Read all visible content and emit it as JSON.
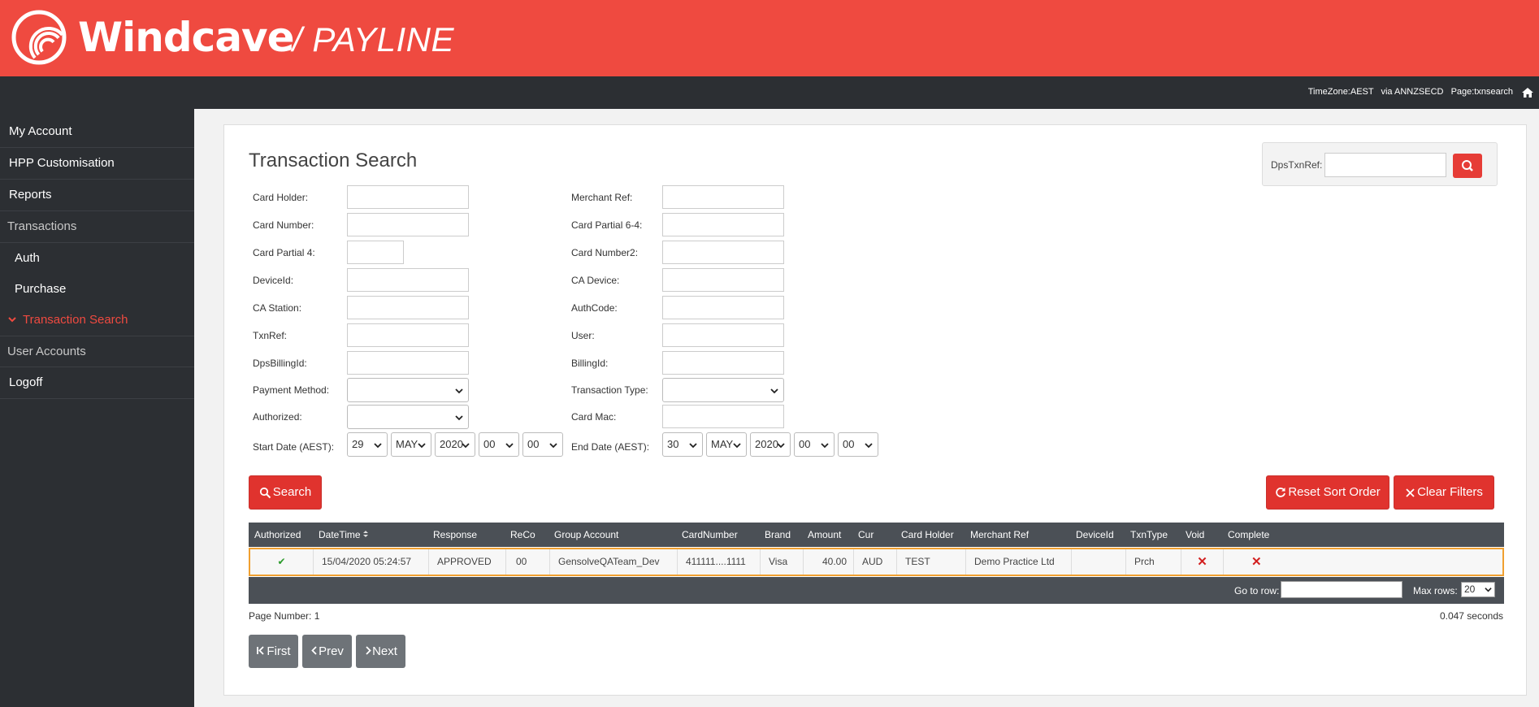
{
  "brand": {
    "name": "Windcave",
    "product": "/ PAYLINE",
    "color": "#ef4a40"
  },
  "status": {
    "timezone": "TimeZone:AEST",
    "via": "via ANNZSECD",
    "page": "Page:txnsearch"
  },
  "sidebar": {
    "items": [
      {
        "label": "My Account"
      },
      {
        "label": "HPP Customisation"
      },
      {
        "label": "Reports"
      },
      {
        "label": "Transactions"
      },
      {
        "label": "Auth"
      },
      {
        "label": "Purchase"
      },
      {
        "label": "Transaction Search"
      },
      {
        "label": "User Accounts"
      },
      {
        "label": "Logoff"
      }
    ]
  },
  "main": {
    "title": "Transaction Search",
    "dps": {
      "label": "DpsTxnRef:",
      "value": ""
    },
    "left_fields": {
      "card_holder": "Card Holder:",
      "card_number": "Card Number:",
      "card_partial4": "Card Partial 4:",
      "device_id": "DeviceId:",
      "ca_station": "CA Station:",
      "txn_ref": "TxnRef:",
      "dps_billing_id": "DpsBillingId:",
      "payment_method": "Payment Method:",
      "authorized": "Authorized:",
      "start_date": "Start Date (AEST):"
    },
    "right_fields": {
      "merchant_ref": "Merchant Ref:",
      "card_partial64": "Card Partial 6-4:",
      "card_number2": "Card Number2:",
      "ca_device": "CA Device:",
      "auth_code": "AuthCode:",
      "user": "User:",
      "billing_id": "BillingId:",
      "transaction_type": "Transaction Type:",
      "card_mac": "Card Mac:",
      "end_date": "End Date (AEST):"
    },
    "start_date": {
      "day": "29",
      "month": "MAY",
      "year": "2020",
      "hour": "00",
      "minute": "00"
    },
    "end_date": {
      "day": "30",
      "month": "MAY",
      "year": "2020",
      "hour": "00",
      "minute": "00"
    },
    "search_label": "Search",
    "reset_label": "Reset Sort Order",
    "clear_label": "Clear Filters"
  },
  "table": {
    "headers": [
      "Authorized",
      "DateTime",
      "Response",
      "ReCo",
      "Group Account",
      "CardNumber",
      "Brand",
      "Amount",
      "Cur",
      "Card Holder",
      "Merchant Ref",
      "DeviceId",
      "TxnType",
      "Void",
      "Complete"
    ],
    "rows": [
      {
        "authorized": "✔",
        "datetime": "15/04/2020 05:24:57",
        "response": "APPROVED",
        "reco": "00",
        "group_account": "GensolveQATeam_Dev",
        "card_number": "411111....1111",
        "brand": "Visa",
        "amount": "40.00",
        "cur": "AUD",
        "card_holder": "TEST",
        "merchant_ref": "Demo Practice Ltd",
        "device_id": "",
        "txn_type": "Prch",
        "void": "✕",
        "complete": "✕"
      }
    ],
    "goto_label": "Go to row:",
    "maxrows_label": "Max rows:",
    "maxrows_value": "20"
  },
  "footer": {
    "page_number": "Page Number: 1",
    "elapsed": "0.047 seconds",
    "first_label": "First",
    "prev_label": "Prev",
    "next_label": "Next"
  }
}
